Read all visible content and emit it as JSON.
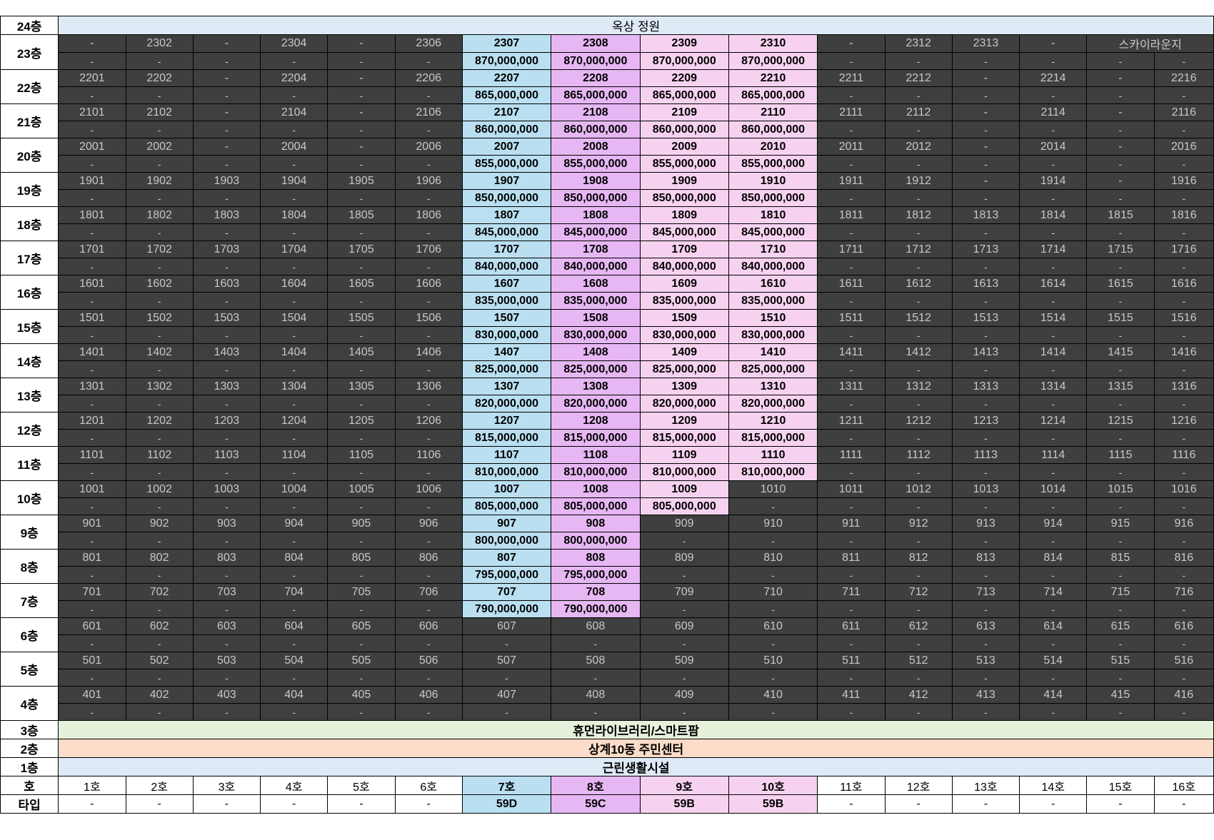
{
  "roof": {
    "floor": "24층",
    "label": "옥상 정원"
  },
  "floors": [
    {
      "floor": "23층",
      "units": [
        "-",
        "2302",
        "-",
        "2304",
        "-",
        "2306",
        "2307",
        "2308",
        "2309",
        "2310",
        "-",
        "2312",
        "2313",
        "-",
        "스카이라운지",
        ""
      ],
      "prices": [
        "-",
        "-",
        "-",
        "-",
        "-",
        "-",
        "870,000,000",
        "870,000,000",
        "870,000,000",
        "870,000,000",
        "-",
        "-",
        "-",
        "-",
        "-",
        "-"
      ],
      "highlight": [
        7,
        8,
        9,
        10
      ],
      "merge_15_16": true
    },
    {
      "floor": "22층",
      "units": [
        "2201",
        "2202",
        "-",
        "2204",
        "-",
        "2206",
        "2207",
        "2208",
        "2209",
        "2210",
        "2211",
        "2212",
        "-",
        "2214",
        "-",
        "2216"
      ],
      "prices": [
        "-",
        "-",
        "-",
        "-",
        "-",
        "-",
        "865,000,000",
        "865,000,000",
        "865,000,000",
        "865,000,000",
        "-",
        "-",
        "-",
        "-",
        "-",
        "-"
      ],
      "highlight": [
        7,
        8,
        9,
        10
      ]
    },
    {
      "floor": "21층",
      "units": [
        "2101",
        "2102",
        "-",
        "2104",
        "-",
        "2106",
        "2107",
        "2108",
        "2109",
        "2110",
        "2111",
        "2112",
        "-",
        "2114",
        "-",
        "2116"
      ],
      "prices": [
        "-",
        "-",
        "-",
        "-",
        "-",
        "-",
        "860,000,000",
        "860,000,000",
        "860,000,000",
        "860,000,000",
        "-",
        "-",
        "-",
        "-",
        "-",
        "-"
      ],
      "highlight": [
        7,
        8,
        9,
        10
      ]
    },
    {
      "floor": "20층",
      "units": [
        "2001",
        "2002",
        "-",
        "2004",
        "-",
        "2006",
        "2007",
        "2008",
        "2009",
        "2010",
        "2011",
        "2012",
        "-",
        "2014",
        "-",
        "2016"
      ],
      "prices": [
        "-",
        "-",
        "-",
        "-",
        "-",
        "-",
        "855,000,000",
        "855,000,000",
        "855,000,000",
        "855,000,000",
        "-",
        "-",
        "-",
        "-",
        "-",
        "-"
      ],
      "highlight": [
        7,
        8,
        9,
        10
      ]
    },
    {
      "floor": "19층",
      "units": [
        "1901",
        "1902",
        "1903",
        "1904",
        "1905",
        "1906",
        "1907",
        "1908",
        "1909",
        "1910",
        "1911",
        "1912",
        "-",
        "1914",
        "-",
        "1916"
      ],
      "prices": [
        "-",
        "-",
        "-",
        "-",
        "-",
        "-",
        "850,000,000",
        "850,000,000",
        "850,000,000",
        "850,000,000",
        "-",
        "-",
        "-",
        "-",
        "-",
        "-"
      ],
      "highlight": [
        7,
        8,
        9,
        10
      ]
    },
    {
      "floor": "18층",
      "units": [
        "1801",
        "1802",
        "1803",
        "1804",
        "1805",
        "1806",
        "1807",
        "1808",
        "1809",
        "1810",
        "1811",
        "1812",
        "1813",
        "1814",
        "1815",
        "1816"
      ],
      "prices": [
        "-",
        "-",
        "-",
        "-",
        "-",
        "-",
        "845,000,000",
        "845,000,000",
        "845,000,000",
        "845,000,000",
        "-",
        "-",
        "-",
        "-",
        "-",
        "-"
      ],
      "highlight": [
        7,
        8,
        9,
        10
      ]
    },
    {
      "floor": "17층",
      "units": [
        "1701",
        "1702",
        "1703",
        "1704",
        "1705",
        "1706",
        "1707",
        "1708",
        "1709",
        "1710",
        "1711",
        "1712",
        "1713",
        "1714",
        "1715",
        "1716"
      ],
      "prices": [
        "-",
        "-",
        "-",
        "-",
        "-",
        "-",
        "840,000,000",
        "840,000,000",
        "840,000,000",
        "840,000,000",
        "-",
        "-",
        "-",
        "-",
        "-",
        "-"
      ],
      "highlight": [
        7,
        8,
        9,
        10
      ]
    },
    {
      "floor": "16층",
      "units": [
        "1601",
        "1602",
        "1603",
        "1604",
        "1605",
        "1606",
        "1607",
        "1608",
        "1609",
        "1610",
        "1611",
        "1612",
        "1613",
        "1614",
        "1615",
        "1616"
      ],
      "prices": [
        "-",
        "-",
        "-",
        "-",
        "-",
        "-",
        "835,000,000",
        "835,000,000",
        "835,000,000",
        "835,000,000",
        "-",
        "-",
        "-",
        "-",
        "-",
        "-"
      ],
      "highlight": [
        7,
        8,
        9,
        10
      ]
    },
    {
      "floor": "15층",
      "units": [
        "1501",
        "1502",
        "1503",
        "1504",
        "1505",
        "1506",
        "1507",
        "1508",
        "1509",
        "1510",
        "1511",
        "1512",
        "1513",
        "1514",
        "1515",
        "1516"
      ],
      "prices": [
        "-",
        "-",
        "-",
        "-",
        "-",
        "-",
        "830,000,000",
        "830,000,000",
        "830,000,000",
        "830,000,000",
        "-",
        "-",
        "-",
        "-",
        "-",
        "-"
      ],
      "highlight": [
        7,
        8,
        9,
        10
      ]
    },
    {
      "floor": "14층",
      "units": [
        "1401",
        "1402",
        "1403",
        "1404",
        "1405",
        "1406",
        "1407",
        "1408",
        "1409",
        "1410",
        "1411",
        "1412",
        "1413",
        "1414",
        "1415",
        "1416"
      ],
      "prices": [
        "-",
        "-",
        "-",
        "-",
        "-",
        "-",
        "825,000,000",
        "825,000,000",
        "825,000,000",
        "825,000,000",
        "-",
        "-",
        "-",
        "-",
        "-",
        "-"
      ],
      "highlight": [
        7,
        8,
        9,
        10
      ]
    },
    {
      "floor": "13층",
      "units": [
        "1301",
        "1302",
        "1303",
        "1304",
        "1305",
        "1306",
        "1307",
        "1308",
        "1309",
        "1310",
        "1311",
        "1312",
        "1313",
        "1314",
        "1315",
        "1316"
      ],
      "prices": [
        "-",
        "-",
        "-",
        "-",
        "-",
        "-",
        "820,000,000",
        "820,000,000",
        "820,000,000",
        "820,000,000",
        "-",
        "-",
        "-",
        "-",
        "-",
        "-"
      ],
      "highlight": [
        7,
        8,
        9,
        10
      ]
    },
    {
      "floor": "12층",
      "units": [
        "1201",
        "1202",
        "1203",
        "1204",
        "1205",
        "1206",
        "1207",
        "1208",
        "1209",
        "1210",
        "1211",
        "1212",
        "1213",
        "1214",
        "1215",
        "1216"
      ],
      "prices": [
        "-",
        "-",
        "-",
        "-",
        "-",
        "-",
        "815,000,000",
        "815,000,000",
        "815,000,000",
        "815,000,000",
        "-",
        "-",
        "-",
        "-",
        "-",
        "-"
      ],
      "highlight": [
        7,
        8,
        9,
        10
      ]
    },
    {
      "floor": "11층",
      "units": [
        "1101",
        "1102",
        "1103",
        "1104",
        "1105",
        "1106",
        "1107",
        "1108",
        "1109",
        "1110",
        "1111",
        "1112",
        "1113",
        "1114",
        "1115",
        "1116"
      ],
      "prices": [
        "-",
        "-",
        "-",
        "-",
        "-",
        "-",
        "810,000,000",
        "810,000,000",
        "810,000,000",
        "810,000,000",
        "-",
        "-",
        "-",
        "-",
        "-",
        "-"
      ],
      "highlight": [
        7,
        8,
        9,
        10
      ]
    },
    {
      "floor": "10층",
      "units": [
        "1001",
        "1002",
        "1003",
        "1004",
        "1005",
        "1006",
        "1007",
        "1008",
        "1009",
        "1010",
        "1011",
        "1012",
        "1013",
        "1014",
        "1015",
        "1016"
      ],
      "prices": [
        "-",
        "-",
        "-",
        "-",
        "-",
        "-",
        "805,000,000",
        "805,000,000",
        "805,000,000",
        "-",
        "-",
        "-",
        "-",
        "-",
        "-",
        "-"
      ],
      "highlight": [
        7,
        8,
        9
      ]
    },
    {
      "floor": "9층",
      "units": [
        "901",
        "902",
        "903",
        "904",
        "905",
        "906",
        "907",
        "908",
        "909",
        "910",
        "911",
        "912",
        "913",
        "914",
        "915",
        "916"
      ],
      "prices": [
        "-",
        "-",
        "-",
        "-",
        "-",
        "-",
        "800,000,000",
        "800,000,000",
        "-",
        "-",
        "-",
        "-",
        "-",
        "-",
        "-",
        "-"
      ],
      "highlight": [
        7,
        8
      ]
    },
    {
      "floor": "8층",
      "units": [
        "801",
        "802",
        "803",
        "804",
        "805",
        "806",
        "807",
        "808",
        "809",
        "810",
        "811",
        "812",
        "813",
        "814",
        "815",
        "816"
      ],
      "prices": [
        "-",
        "-",
        "-",
        "-",
        "-",
        "-",
        "795,000,000",
        "795,000,000",
        "-",
        "-",
        "-",
        "-",
        "-",
        "-",
        "-",
        "-"
      ],
      "highlight": [
        7,
        8
      ]
    },
    {
      "floor": "7층",
      "units": [
        "701",
        "702",
        "703",
        "704",
        "705",
        "706",
        "707",
        "708",
        "709",
        "710",
        "711",
        "712",
        "713",
        "714",
        "715",
        "716"
      ],
      "prices": [
        "-",
        "-",
        "-",
        "-",
        "-",
        "-",
        "790,000,000",
        "790,000,000",
        "-",
        "-",
        "-",
        "-",
        "-",
        "-",
        "-",
        "-"
      ],
      "highlight": [
        7,
        8
      ]
    },
    {
      "floor": "6층",
      "units": [
        "601",
        "602",
        "603",
        "604",
        "605",
        "606",
        "607",
        "608",
        "609",
        "610",
        "611",
        "612",
        "613",
        "614",
        "615",
        "616"
      ],
      "prices": [
        "-",
        "-",
        "-",
        "-",
        "-",
        "-",
        "-",
        "-",
        "-",
        "-",
        "-",
        "-",
        "-",
        "-",
        "-",
        "-"
      ],
      "highlight": []
    },
    {
      "floor": "5층",
      "units": [
        "501",
        "502",
        "503",
        "504",
        "505",
        "506",
        "507",
        "508",
        "509",
        "510",
        "511",
        "512",
        "513",
        "514",
        "515",
        "516"
      ],
      "prices": [
        "-",
        "-",
        "-",
        "-",
        "-",
        "-",
        "-",
        "-",
        "-",
        "-",
        "-",
        "-",
        "-",
        "-",
        "-",
        "-"
      ],
      "highlight": []
    },
    {
      "floor": "4층",
      "units": [
        "401",
        "402",
        "403",
        "404",
        "405",
        "406",
        "407",
        "408",
        "409",
        "410",
        "411",
        "412",
        "413",
        "414",
        "415",
        "416"
      ],
      "prices": [
        "-",
        "-",
        "-",
        "-",
        "-",
        "-",
        "-",
        "-",
        "-",
        "-",
        "-",
        "-",
        "-",
        "-",
        "-",
        "-"
      ],
      "highlight": []
    }
  ],
  "bands": [
    {
      "floor": "3층",
      "label": "휴먼라이브러리/스마트팜",
      "kind": "f3"
    },
    {
      "floor": "2층",
      "label": "상계10동 주민센터",
      "kind": "f2"
    },
    {
      "floor": "1층",
      "label": "근린생활시설",
      "kind": "f1"
    }
  ],
  "unit_row": {
    "label": "호",
    "cells": [
      "1호",
      "2호",
      "3호",
      "4호",
      "5호",
      "6호",
      "7호",
      "8호",
      "9호",
      "10호",
      "11호",
      "12호",
      "13호",
      "14호",
      "15호",
      "16호"
    ]
  },
  "type_row": {
    "label": "타입",
    "cells": [
      "-",
      "-",
      "-",
      "-",
      "-",
      "-",
      "59D",
      "59C",
      "59B",
      "59B",
      "-",
      "-",
      "-",
      "-",
      "-",
      "-"
    ]
  },
  "colors": {
    "col7": "#b9dff0",
    "col8": "#e6b7f3",
    "col9": "#f7d2f0",
    "col10": "#f7d2f0",
    "unit_bg": "#3f3f3f"
  }
}
